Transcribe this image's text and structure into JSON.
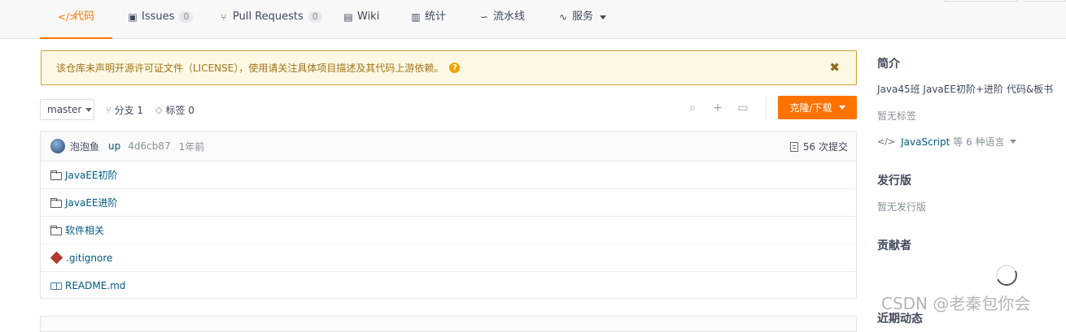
{
  "tabs": [
    {
      "icon": "</>",
      "label": "代码",
      "active": true
    },
    {
      "icon": "▣",
      "label": "Issues",
      "count": "0"
    },
    {
      "icon": "⑂",
      "label": "Pull Requests",
      "count": "0"
    },
    {
      "icon": "▤",
      "label": "Wiki"
    },
    {
      "icon": "▥",
      "label": "统计"
    },
    {
      "icon": "∽",
      "label": "流水线"
    },
    {
      "icon": "∿",
      "label": "服务"
    }
  ],
  "notice": {
    "text": "该仓库未声明开源许可证文件（LICENSE），使用请关注具体项目描述及其代码上游依赖。",
    "help": "?",
    "close": "✖"
  },
  "toolbar": {
    "branch": "master",
    "branches_label": "分支 1",
    "tags_label": "标签 0",
    "clone_label": "克隆/下载"
  },
  "commit": {
    "author": "泡泡鱼",
    "message": "up",
    "hash": "4d6cb87",
    "time": "1年前",
    "count_label": "56 次提交"
  },
  "files": [
    {
      "type": "folder",
      "name": "JavaEE初阶"
    },
    {
      "type": "folder",
      "name": "JavaEE进阶"
    },
    {
      "type": "folder",
      "name": "软件相关"
    },
    {
      "type": "gitignore",
      "name": ".gitignore"
    },
    {
      "type": "readme",
      "name": "README.md"
    }
  ],
  "sidebar": {
    "intro_heading": "简介",
    "intro_text": "Java45班 JavaEE初阶+进阶 代码&板书",
    "no_tags": "暂无标签",
    "lang_name": "JavaScript",
    "lang_rest": "等 6 种语言",
    "release_heading": "发行版",
    "no_release": "暂无发行版",
    "contrib_heading": "贡献者",
    "activity_heading": "近期动态"
  },
  "watermark": "CSDN @老秦包你会",
  "colors": {
    "accent": "#fe7300",
    "link": "#005980",
    "notice_bg": "#fcf8e3"
  }
}
